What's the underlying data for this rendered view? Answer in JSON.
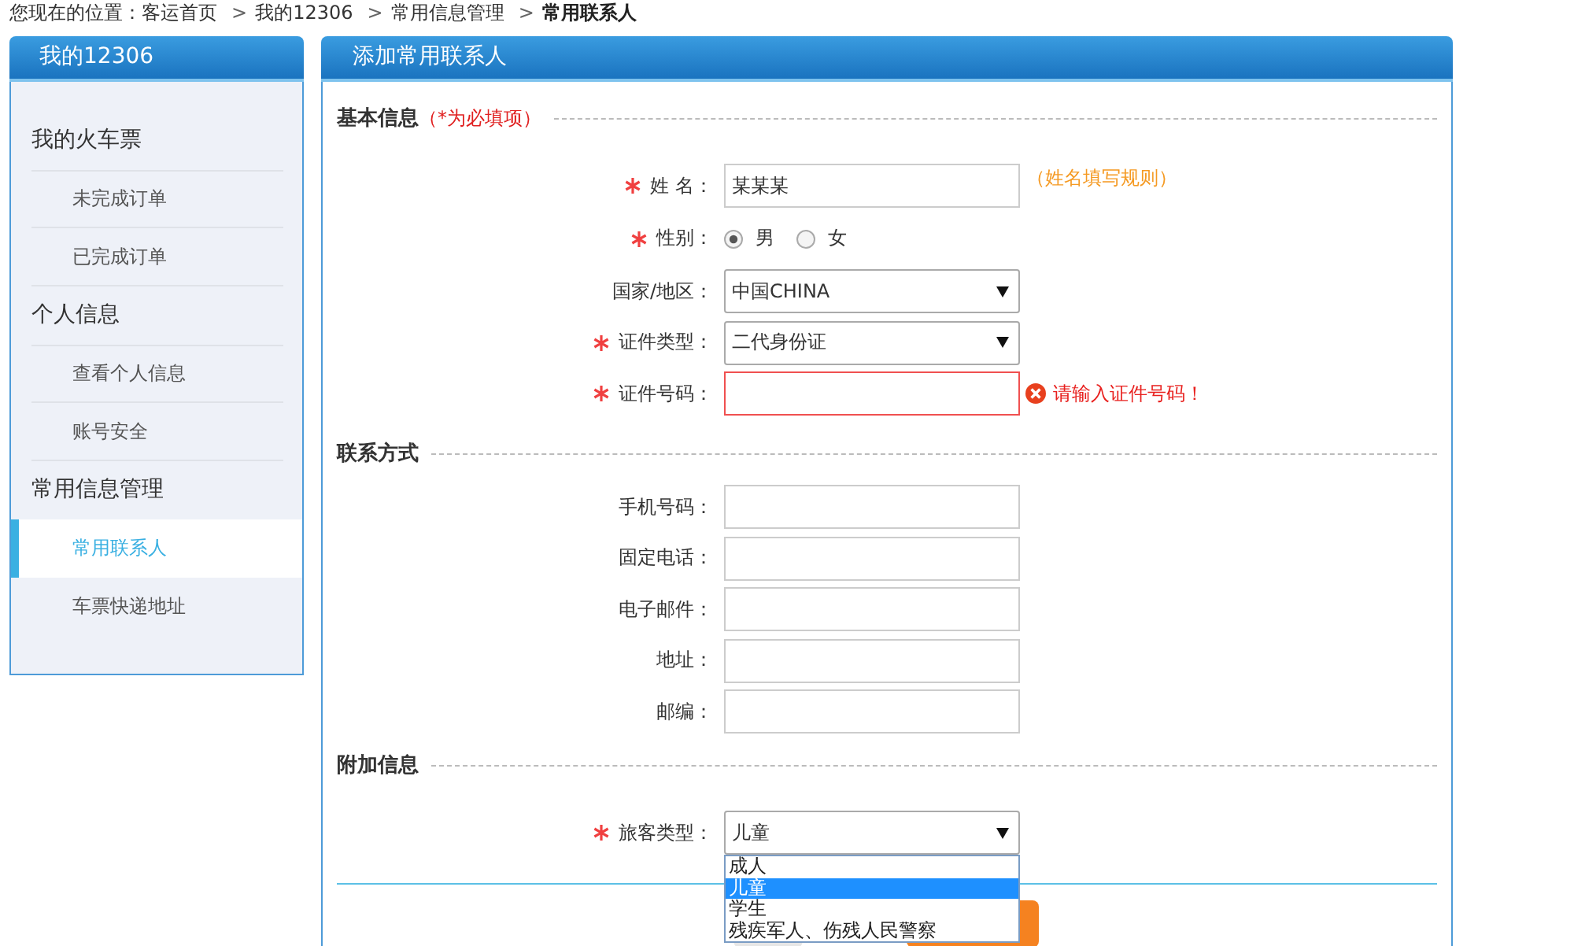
{
  "breadcrumb": {
    "prefix": "您现在的位置：",
    "items": [
      {
        "label": "客运首页",
        "current": false
      },
      {
        "separator": ">",
        "label": "我的12306",
        "current": false
      },
      {
        "separator": ">",
        "label": "常用信息管理",
        "current": false
      },
      {
        "separator": ">",
        "label": "常用联系人",
        "current": true
      }
    ]
  },
  "sidebar": {
    "title": "我的12306",
    "groups": [
      {
        "label": "我的火车票",
        "children": [
          {
            "label": "未完成订单",
            "selected": false
          },
          {
            "label": "已完成订单",
            "selected": false
          }
        ]
      },
      {
        "label": "个人信息",
        "children": [
          {
            "label": "查看个人信息",
            "selected": false
          },
          {
            "label": "账号安全",
            "selected": false
          }
        ]
      },
      {
        "label": "常用信息管理",
        "children": [
          {
            "label": "常用联系人",
            "selected": true
          },
          {
            "label": "车票快递地址",
            "selected": false
          }
        ]
      }
    ]
  },
  "form": {
    "title": "添加常用联系人",
    "sections": [
      {
        "title": "基本信息",
        "note": "（*为必填项）",
        "fields": [
          {
            "kind": "text",
            "label": "姓 名：",
            "required": true,
            "value": "某某某",
            "hint": "（姓名填写规则）"
          },
          {
            "kind": "radio",
            "label": "性别：",
            "required": true,
            "options": [
              {
                "label": "男",
                "selected": true
              },
              {
                "label": "女",
                "selected": false
              }
            ]
          },
          {
            "kind": "select",
            "label": "国家/地区：",
            "required": false,
            "value": "中国CHINA"
          },
          {
            "kind": "select",
            "label": "证件类型：",
            "required": true,
            "value": "二代身份证"
          },
          {
            "kind": "text",
            "label": "证件号码：",
            "required": true,
            "invalid": true,
            "error": "请输入证件号码！"
          }
        ]
      },
      {
        "title": "联系方式",
        "fields": [
          {
            "kind": "text",
            "label": "手机号码：",
            "required": false
          },
          {
            "kind": "text",
            "label": "固定电话：",
            "required": false
          },
          {
            "kind": "text",
            "label": "电子邮件：",
            "required": false
          },
          {
            "kind": "text",
            "label": "地址：",
            "required": false
          },
          {
            "kind": "text",
            "label": "邮编：",
            "required": false
          }
        ]
      },
      {
        "title": "附加信息",
        "fields": [
          {
            "kind": "select",
            "label": "旅客类型：",
            "required": true,
            "value": "儿童",
            "expanded": true,
            "options": [
              {
                "label": "成人",
                "selected": false
              },
              {
                "label": "儿童",
                "selected": true
              },
              {
                "label": "学生",
                "selected": false
              },
              {
                "label": "残疾军人、伤残人民警察",
                "selected": false
              }
            ]
          }
        ]
      }
    ],
    "buttons": [
      {
        "kind": "default"
      },
      {
        "kind": "primary"
      }
    ]
  }
}
